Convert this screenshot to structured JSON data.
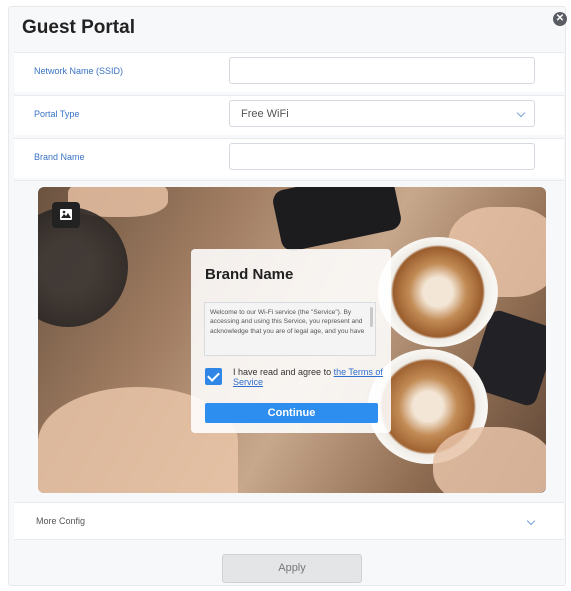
{
  "header": {
    "title": "Guest Portal"
  },
  "form": {
    "ssid_label": "Network Name (SSID)",
    "ssid_value": "",
    "portal_type_label": "Portal Type",
    "portal_type_value": "Free WiFi",
    "brand_name_label": "Brand Name",
    "brand_name_value": ""
  },
  "preview": {
    "card_title": "Brand Name",
    "tos_text": "Welcome to our Wi-Fi service (the \"Service\"). By accessing and using this Service, you represent and acknowledge that you are of legal age, and you have",
    "agree_text": "I have read and agree to ",
    "terms_link": "the Terms of Service",
    "continue_label": "Continue",
    "checkbox_checked": true,
    "accent_color": "#2d8ef0"
  },
  "more_config": {
    "label": "More Config"
  },
  "footer": {
    "apply_label": "Apply"
  },
  "icons": {
    "close": "close-icon",
    "image": "image-icon",
    "chevron": "chevron-down-icon"
  }
}
